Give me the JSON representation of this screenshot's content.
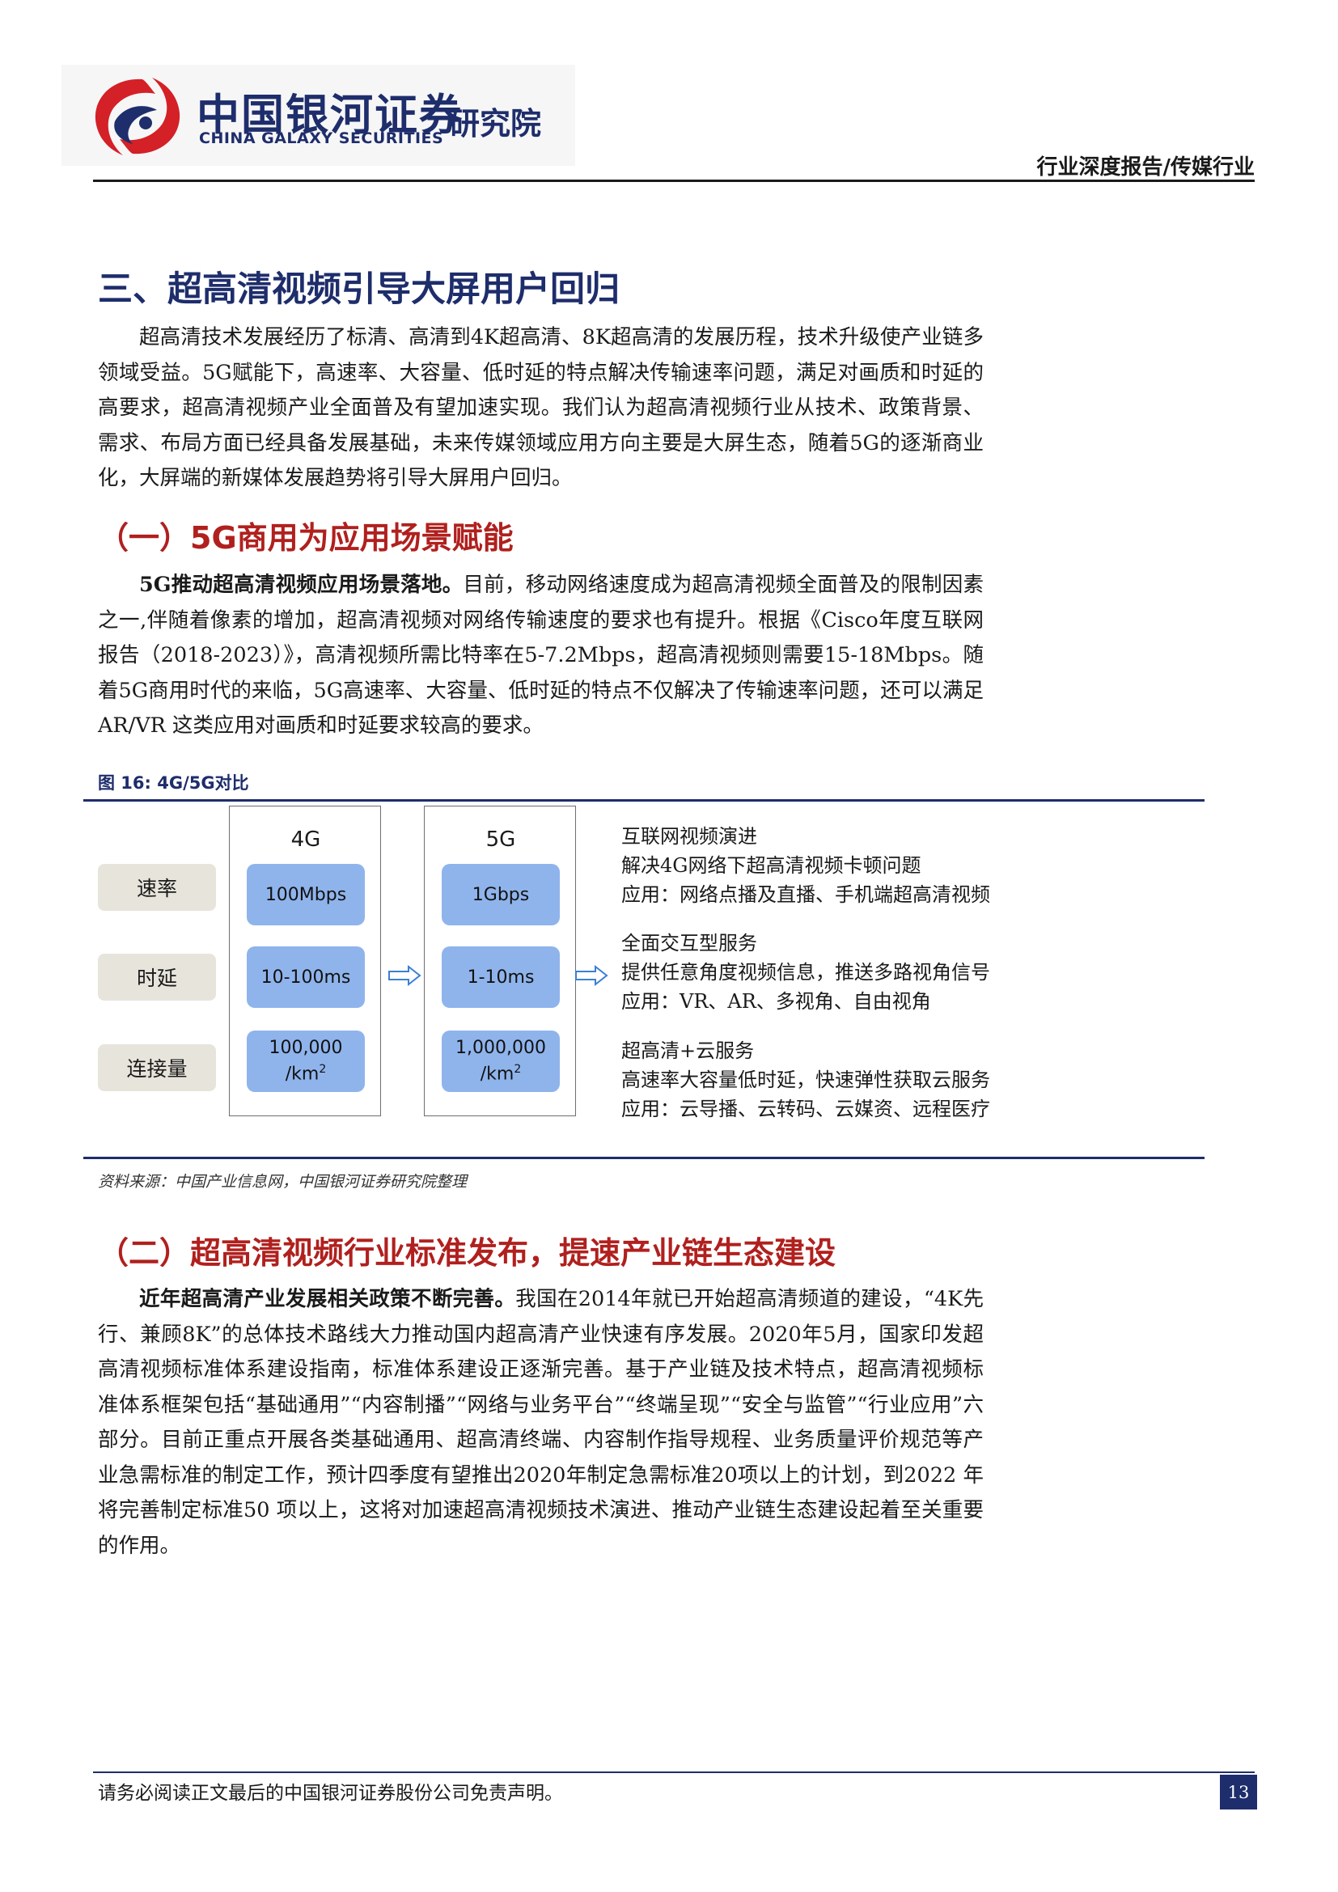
{
  "header": {
    "brand_cn": "中国银河证券",
    "brand_en": "CHINA GALAXY SECURITIES",
    "institute": "研究院",
    "report_type": "行业深度报告/传媒行业",
    "brand_color": "#1e2d6b",
    "logo_red": "#d42027"
  },
  "section3": {
    "title": "三、超高清视频引导大屏用户回归",
    "para": "超高清技术发展经历了标清、高清到4K超高清、8K超高清的发展历程，技术升级使产业链多领域受益。5G赋能下，高速率、大容量、低时延的特点解决传输速率问题，满足对画质和时延的高要求，超高清视频产业全面普及有望加速实现。我们认为超高清视频行业从技术、政策背景、需求、布局方面已经具备发展基础，未来传媒领域应用方向主要是大屏生态，随着5G的逐渐商业化，大屏端的新媒体发展趋势将引导大屏用户回归。"
  },
  "sub1": {
    "title": "（一）5G商用为应用场景赋能",
    "lead": "5G推动超高清视频应用场景落地。",
    "body": "目前，移动网络速度成为超高清视频全面普及的限制因素之一,伴随着像素的增加，超高清视频对网络传输速度的要求也有提升。根据《Cisco年度互联网报告（2018-2023）》，高清视频所需比特率在5-7.2Mbps，超高清视频则需要15-18Mbps。随着5G商用时代的来临，5G高速率、大容量、低时延的特点不仅解决了传输速率问题，还可以满足 AR/VR 这类应用对画质和时延要求较高的要求。"
  },
  "figure": {
    "caption": "图 16:  4G/5G对比",
    "row_labels": [
      "速率",
      "时延",
      "连接量"
    ],
    "col_4g": {
      "title": "4G",
      "cells": [
        "100Mbps",
        "10-100ms"
      ],
      "conn_value": "100,000",
      "conn_unit": "/km",
      "conn_sup": "2"
    },
    "col_5g": {
      "title": "5G",
      "cells": [
        "1Gbps",
        "1-10ms"
      ],
      "conn_value": "1,000,000",
      "conn_unit": "/km",
      "conn_sup": "2"
    },
    "descriptions": [
      {
        "title": "互联网视频演进",
        "line1": "解决4G网络下超高清视频卡顿问题",
        "line2": "应用：网络点播及直播、手机端超高清视频"
      },
      {
        "title": "全面交互型服务",
        "line1": "提供任意角度视频信息，推送多路视角信号",
        "line2": "应用：VR、AR、多视角、自由视角"
      },
      {
        "title": "超高清+云服务",
        "line1": "高速率大容量低时延，快速弹性获取云服务",
        "line2": "应用：云导播、云转码、云媒资、远程医疗"
      }
    ],
    "source": "资料来源：中国产业信息网，中国银河证券研究院整理",
    "label_bg": "#e7e4dc",
    "cell_color": "#8fb4ec",
    "arrow_color": "#3c7fd4"
  },
  "sub2": {
    "title": "（二）超高清视频行业标准发布，提速产业链生态建设",
    "lead": "近年超高清产业发展相关政策不断完善。",
    "body": "我国在2014年就已开始超高清频道的建设，“4K先行、兼顾8K”的总体技术路线大力推动国内超高清产业快速有序发展。2020年5月，国家印发超高清视频标准体系建设指南，标准体系建设正逐渐完善。基于产业链及技术特点，超高清视频标准体系框架包括“基础通用”“内容制播”“网络与业务平台”“终端呈现”“安全与监管”“行业应用”六部分。目前正重点开展各类基础通用、超高清终端、内容制作指导规程、业务质量评价规范等产业急需标准的制定工作，预计四季度有望推出2020年制定急需标准20项以上的计划，到2022 年将完善制定标准50 项以上，这将对加速超高清视频技术演进、推动产业链生态建设起着至关重要的作用。"
  },
  "footer": {
    "note": "请务必阅读正文最后的中国银河证券股份公司免责声明。",
    "page": "13"
  }
}
